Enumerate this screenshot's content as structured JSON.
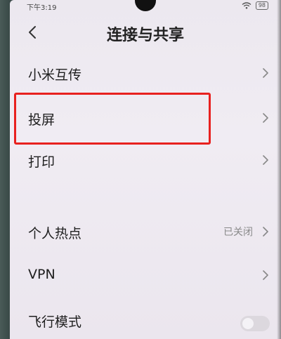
{
  "status_bar": {
    "time": "下午3:19",
    "battery": "98",
    "icons": [
      "wifi-icon",
      "battery-icon"
    ]
  },
  "header": {
    "title": "连接与共享",
    "back_icon": "back-arrow-icon"
  },
  "items": [
    {
      "label": "小米互传",
      "value": "",
      "control": "chevron"
    },
    {
      "label": "投屏",
      "value": "",
      "control": "chevron",
      "highlighted": true
    },
    {
      "label": "打印",
      "value": "",
      "control": "chevron"
    },
    {
      "label": "个人热点",
      "value": "已关闭",
      "control": "chevron"
    },
    {
      "label": "VPN",
      "value": "",
      "control": "chevron"
    },
    {
      "label": "飞行模式",
      "value": "",
      "control": "toggle",
      "toggle_on": false
    }
  ],
  "colors": {
    "highlight": "#e8211f",
    "background": "#ece8ef",
    "text": "#1e1e1e",
    "secondary_text": "#8a8a8a"
  }
}
